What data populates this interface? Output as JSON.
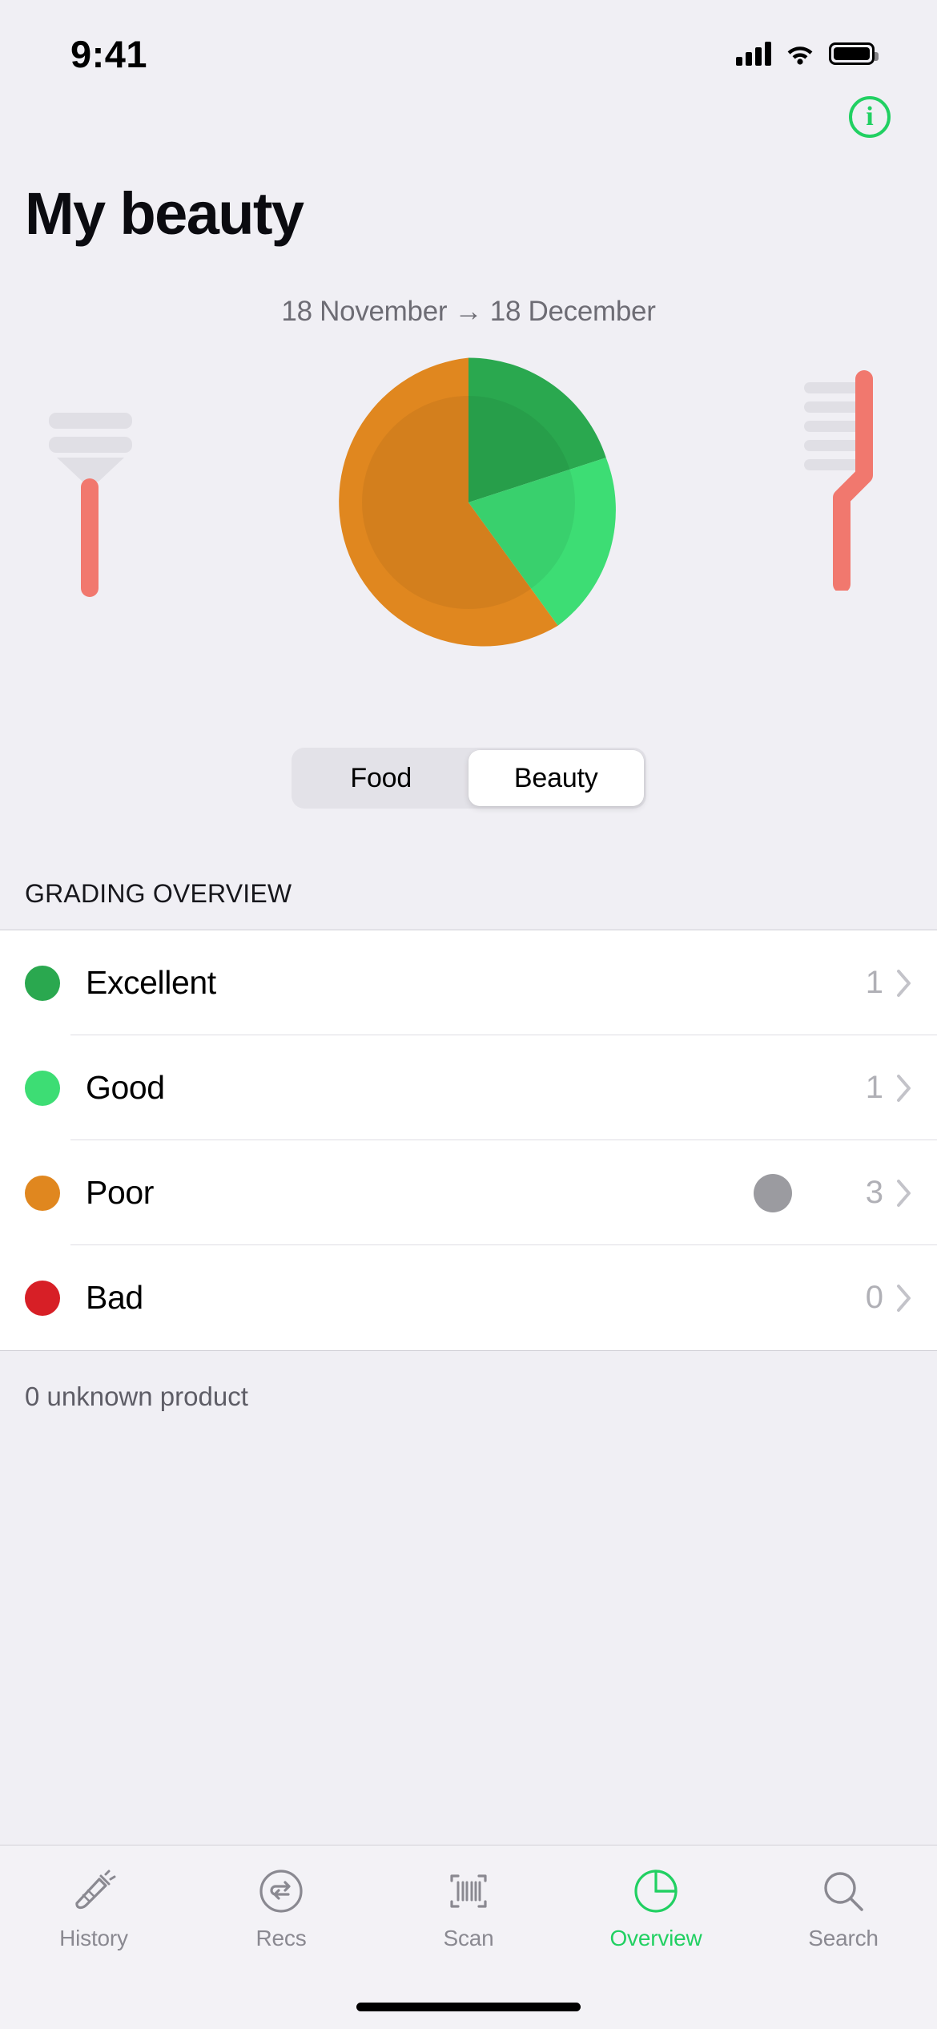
{
  "status_bar": {
    "time": "9:41",
    "signal_icon": "cellular-bars-icon",
    "wifi_icon": "wifi-icon",
    "battery_icon": "battery-full-icon"
  },
  "header": {
    "info_button_label": "i",
    "info_button_icon": "info-circle-icon",
    "title": "My beauty",
    "date_range": "18 November → 18 December"
  },
  "decorations": {
    "left_icon": "razor-icon",
    "right_icon": "toothbrush-icon",
    "handle_color": "#f1786e",
    "bristle_color": "#e0dfe5"
  },
  "segmented_control": {
    "options": [
      {
        "label": "Food",
        "selected": false
      },
      {
        "label": "Beauty",
        "selected": true
      }
    ]
  },
  "grading_overview": {
    "section_title": "GRADING OVERVIEW",
    "rows": [
      {
        "label": "Excellent",
        "count": "1",
        "color": "#2aa84f",
        "has_bubble": false
      },
      {
        "label": "Good",
        "count": "1",
        "color": "#3ddd74",
        "has_bubble": false
      },
      {
        "label": "Poor",
        "count": "3",
        "color": "#e0871f",
        "has_bubble": true
      },
      {
        "label": "Bad",
        "count": "0",
        "color": "#d71f26",
        "has_bubble": false
      }
    ],
    "footer_note": "0 unknown product"
  },
  "tab_bar": {
    "tabs": [
      {
        "label": "History",
        "icon": "carrot-icon",
        "active": false
      },
      {
        "label": "Recs",
        "icon": "swap-circle-icon",
        "active": false
      },
      {
        "label": "Scan",
        "icon": "barcode-icon",
        "active": false
      },
      {
        "label": "Overview",
        "icon": "pie-chart-icon",
        "active": true
      },
      {
        "label": "Search",
        "icon": "magnifier-icon",
        "active": false
      }
    ],
    "active_color": "#21d062",
    "inactive_color": "#8a8991"
  },
  "chart_data": {
    "type": "pie",
    "title": "Beauty grading distribution",
    "categories": [
      "Excellent",
      "Good",
      "Poor",
      "Bad"
    ],
    "values": [
      1,
      1,
      3,
      0
    ],
    "total": 5,
    "percentages": [
      20,
      20,
      60,
      0
    ],
    "colors": [
      "#2aa84f",
      "#3ddd74",
      "#e0871f",
      "#d71f26"
    ],
    "start_angle_deg": 0,
    "direction": "clockwise",
    "legend_position": "below-as-list",
    "grid": false,
    "inner_shadow_ring": true,
    "inner_ring_radius_ratio": 0.74,
    "slices": [
      {
        "label": "Excellent",
        "value": 1,
        "percent": 20,
        "color": "#2aa84f",
        "from_deg": 0,
        "to_deg": 72
      },
      {
        "label": "Good",
        "value": 1,
        "percent": 20,
        "color": "#3ddd74",
        "from_deg": 72,
        "to_deg": 144
      },
      {
        "label": "Poor",
        "value": 3,
        "percent": 60,
        "color": "#e0871f",
        "from_deg": 144,
        "to_deg": 360
      },
      {
        "label": "Bad",
        "value": 0,
        "percent": 0,
        "color": "#d71f26",
        "from_deg": 360,
        "to_deg": 360
      }
    ]
  }
}
